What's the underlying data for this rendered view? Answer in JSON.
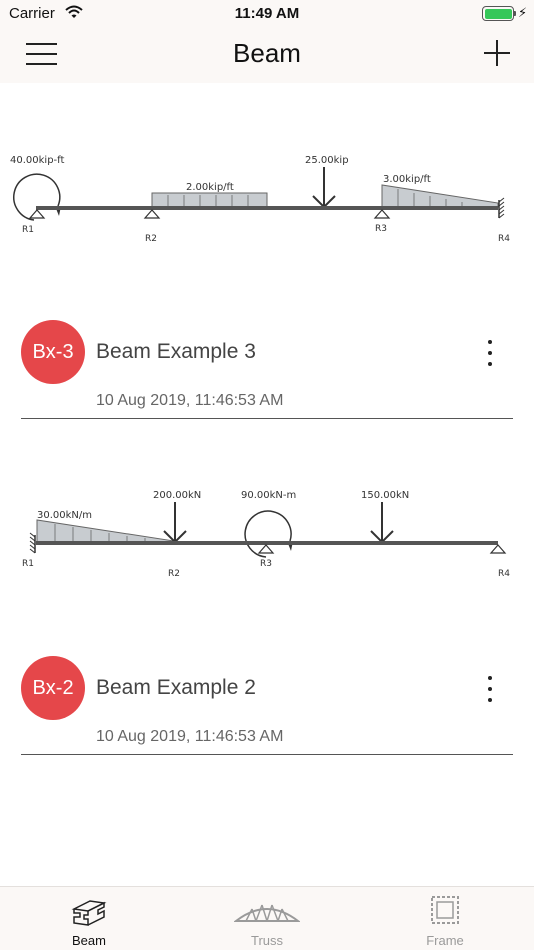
{
  "status_bar": {
    "carrier": "Carrier",
    "time": "11:49 AM"
  },
  "nav": {
    "title": "Beam"
  },
  "items": [
    {
      "badge": "Bx-3",
      "title": "Beam Example 3",
      "date": "10 Aug 2019, 11:46:53 AM",
      "diagram": {
        "moment": "40.00kip-ft",
        "udl": "2.00kip/ft",
        "point": "25.00kip",
        "tri": "3.00kip/ft",
        "supports": [
          "R1",
          "R2",
          "R3",
          "R4"
        ]
      }
    },
    {
      "badge": "Bx-2",
      "title": "Beam Example 2",
      "date": "10 Aug 2019, 11:46:53 AM",
      "diagram": {
        "tri": "30.00kN/m",
        "point1": "200.00kN",
        "moment": "90.00kN-m",
        "point2": "150.00kN",
        "supports": [
          "R1",
          "R2",
          "R3",
          "R4"
        ]
      }
    }
  ],
  "tabs": [
    {
      "label": "Beam",
      "icon": "beam-icon",
      "active": true
    },
    {
      "label": "Truss",
      "icon": "truss-icon",
      "active": false
    },
    {
      "label": "Frame",
      "icon": "frame-icon",
      "active": false
    }
  ],
  "colors": {
    "badge": "#e5474a",
    "accent": "#111111",
    "inactive_tab": "#9a9a9a",
    "load_fill": "#c8ccd0"
  }
}
